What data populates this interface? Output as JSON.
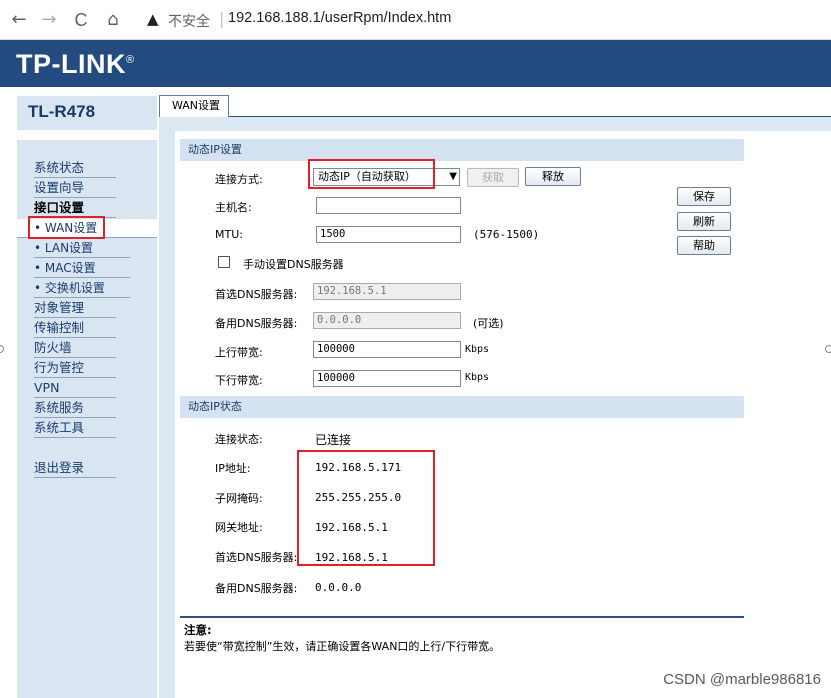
{
  "browser": {
    "back_icon": "←",
    "forward_icon": "→",
    "reload_icon": "C",
    "home_icon": "⌂",
    "security_text": "不安全",
    "separator": "|",
    "url": "192.168.188.1/userRpm/Index.htm"
  },
  "brand": {
    "logo": "TP-LINK",
    "logo_mark": "®",
    "model": "TL-R478"
  },
  "sidebar": {
    "items": [
      {
        "label": "系统状态"
      },
      {
        "label": "设置向导"
      },
      {
        "label": "接口设置"
      },
      {
        "label": "• WAN设置"
      },
      {
        "label": "• LAN设置"
      },
      {
        "label": "• MAC设置"
      },
      {
        "label": "• 交换机设置"
      },
      {
        "label": "对象管理"
      },
      {
        "label": "传输控制"
      },
      {
        "label": "防火墙"
      },
      {
        "label": "行为管控"
      },
      {
        "label": "VPN"
      },
      {
        "label": "系统服务"
      },
      {
        "label": "系统工具"
      },
      {
        "label": "退出登录"
      }
    ]
  },
  "tab": {
    "label": "WAN设置"
  },
  "settings": {
    "section_title": "动态IP设置",
    "connection_label": "连接方式:",
    "connection_value": "动态IP（自动获取）",
    "obtain_button": "获取",
    "release_button": "释放",
    "hostname_label": "主机名:",
    "hostname_value": "",
    "mtu_label": "MTU:",
    "mtu_value": "1500",
    "mtu_hint": "(576-1500)",
    "manual_dns_label": "手动设置DNS服务器",
    "primary_dns_label": "首选DNS服务器:",
    "primary_dns_value": "192.168.5.1",
    "secondary_dns_label": "备用DNS服务器:",
    "secondary_dns_value": "0.0.0.0",
    "optional_hint": "(可选)",
    "upstream_label": "上行带宽:",
    "upstream_value": "100000",
    "downstream_label": "下行带宽:",
    "downstream_value": "100000",
    "unit": "Kbps"
  },
  "actions": {
    "save": "保存",
    "refresh": "刷新",
    "help": "帮助"
  },
  "status": {
    "section_title": "动态IP状态",
    "state_label": "连接状态:",
    "state_value": "已连接",
    "ip_label": "IP地址:",
    "ip_value": "192.168.5.171",
    "mask_label": "子网掩码:",
    "mask_value": "255.255.255.0",
    "gateway_label": "网关地址:",
    "gateway_value": "192.168.5.1",
    "primary_dns_label": "首选DNS服务器:",
    "primary_dns_value": "192.168.5.1",
    "secondary_dns_label": "备用DNS服务器:",
    "secondary_dns_value": "0.0.0.0"
  },
  "notice": {
    "title": "注意:",
    "text": "若要使“带宽控制”生效，请正确设置各WAN口的上行/下行带宽。"
  },
  "watermark": "CSDN @marble986816",
  "colors": {
    "banner": "#244b80",
    "panel": "#d9e6f2",
    "highlight": "#e0202a"
  }
}
